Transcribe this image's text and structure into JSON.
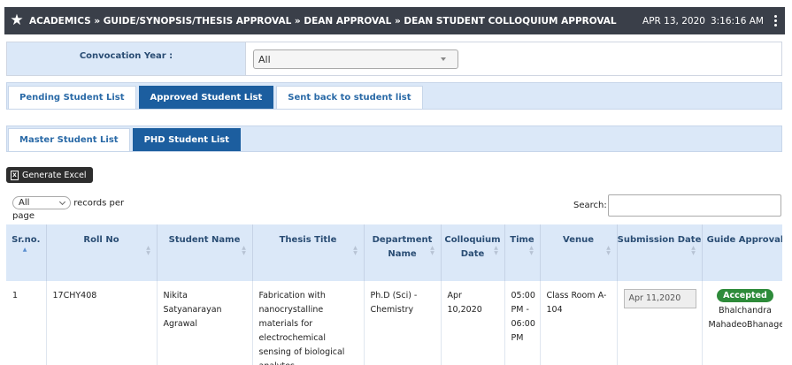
{
  "header": {
    "breadcrumb": "ACADEMICS » GUIDE/SYNOPSIS/THESIS APPROVAL » DEAN APPROVAL » DEAN STUDENT COLLOQUIUM APPROVAL",
    "date": "APR 13, 2020",
    "time": "3:16:16 AM"
  },
  "filter": {
    "convocation_label": "Convocation Year :",
    "convocation_value": "All"
  },
  "status_tabs": [
    "Pending Student List",
    "Approved Student List",
    "Sent back to student list"
  ],
  "type_tabs": [
    "Master Student List",
    "PHD Student List"
  ],
  "toolbar": {
    "excel_label": "Generate Excel"
  },
  "table_controls": {
    "length_value": "All",
    "length_suffix": "records per",
    "length_suffix2": "page",
    "search_label": "Search:"
  },
  "table": {
    "headers": [
      "Sr.no.",
      "Roll No",
      "Student Name",
      "Thesis Title",
      "Department Name",
      "Colloquium Date",
      "Time",
      "Venue",
      "Submission Date",
      "Guide Approval"
    ],
    "rows": [
      {
        "srno": "1",
        "roll": "17CHY408",
        "name": "Nikita Satyanarayan Agrawal",
        "title": "Fabrication with nanocrystalline materials for electrochemical sensing of biological analytes.",
        "dept": "Ph.D (Sci) - Chemistry",
        "col_date": "Apr 10,2020",
        "time": "05:00 PM - 06:00 PM",
        "venue": "Class Room A-104",
        "submission": "Apr 11,2020",
        "approval_status": "Accepted",
        "guide": "Bhalchandra MahadeoBhanage"
      }
    ]
  },
  "colors": {
    "header_bg": "#3a3f49",
    "tab_active": "#1c5e9f",
    "panel_bg": "#dbe8f8",
    "accepted": "#2e8b3a"
  }
}
